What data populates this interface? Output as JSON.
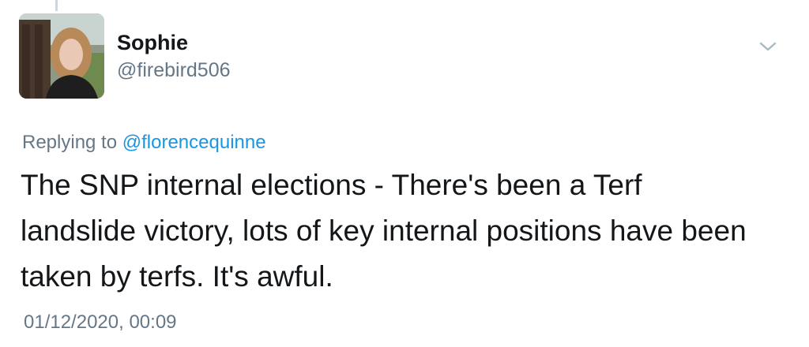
{
  "tweet": {
    "author": {
      "display_name": "Sophie",
      "handle": "@firebird506",
      "avatar_icon": "profile-photo"
    },
    "menu_icon": "chevron-down-icon",
    "replying_to": {
      "prefix": "Replying to",
      "mention": "@florencequinne"
    },
    "text_lines": [
      "The SNP internal elections - There's been a Terf",
      "landslide victory, lots of key internal positions have been",
      "taken by terfs. It's awful."
    ],
    "timestamp": "01/12/2020, 00:09"
  },
  "colors": {
    "text": "#14171a",
    "secondary": "#657786",
    "link": "#1b95e0",
    "thread_line": "#ccd6dd"
  }
}
